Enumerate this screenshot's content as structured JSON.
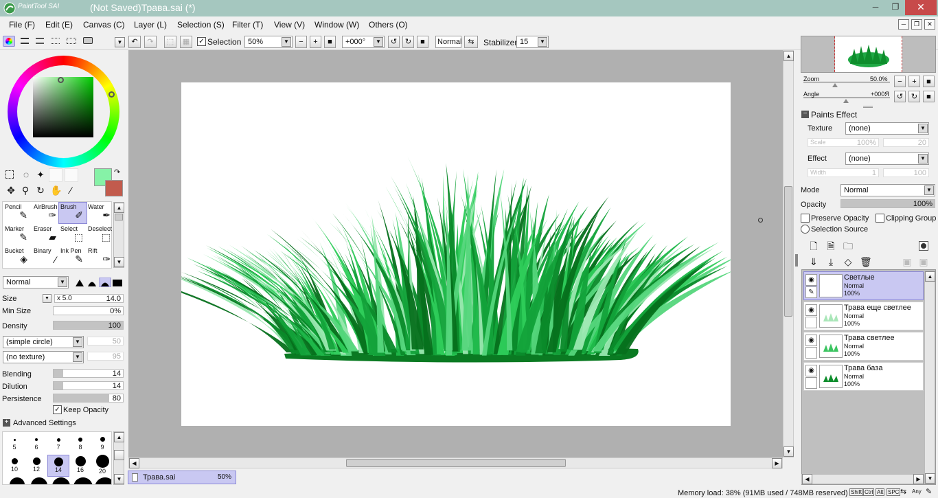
{
  "window": {
    "app_logo_text": "PaintTool SAI",
    "title": "(Not Saved)Трава.sai (*)",
    "minimize": "─",
    "maximize": "❐",
    "close": "✕"
  },
  "menu": [
    "File (F)",
    "Edit (E)",
    "Canvas (C)",
    "Layer (L)",
    "Selection (S)",
    "Filter (T)",
    "View (V)",
    "Window (W)",
    "Others (O)"
  ],
  "toolbar": {
    "selection_label": "Selection",
    "selection_checked": true,
    "zoom": "50%",
    "angle": "+000°",
    "blend_mode": "Normal",
    "stabilizer_label": "Stabilizer",
    "stabilizer_value": "15"
  },
  "colors": {
    "foreground": "#86f2a7",
    "background": "#c25b4d",
    "accent": "#c9c8f2",
    "grass_dark": "#007f1f",
    "grass_light": "#2ecc5a"
  },
  "tools": [
    {
      "label": "Pencil",
      "icon": "pencil-icon"
    },
    {
      "label": "AirBrush",
      "icon": "airbrush-icon"
    },
    {
      "label": "Brush",
      "icon": "brush-icon",
      "active": true
    },
    {
      "label": "Water",
      "icon": "water-icon"
    },
    {
      "label": "Marker",
      "icon": "marker-icon"
    },
    {
      "label": "Eraser",
      "icon": "eraser-icon"
    },
    {
      "label": "Select",
      "icon": "select-icon"
    },
    {
      "label": "Deselect",
      "icon": "deselect-icon"
    },
    {
      "label": "Bucket",
      "icon": "bucket-icon"
    },
    {
      "label": "Binary",
      "icon": "binary-icon"
    },
    {
      "label": "Ink Pen",
      "icon": "ink-pen-icon"
    },
    {
      "label": "Rift",
      "icon": "rift-icon"
    }
  ],
  "brush": {
    "mode": "Normal",
    "size_label": "Size",
    "size_multiplier": "x 5.0",
    "size_value": "14.0",
    "min_size_label": "Min Size",
    "min_size_value": "0%",
    "density_label": "Density",
    "density_value": "100",
    "shape": "(simple circle)",
    "shape_value": "50",
    "texture": "(no texture)",
    "texture_value": "95",
    "blending_label": "Blending",
    "blending_value": "14",
    "dilution_label": "Dilution",
    "dilution_value": "14",
    "persistence_label": "Persistence",
    "persistence_value": "80",
    "keep_opacity_label": "Keep Opacity",
    "keep_opacity_checked": true,
    "advanced_label": "Advanced Settings"
  },
  "brush_sizes": [
    "5",
    "6",
    "7",
    "8",
    "9",
    "10",
    "12",
    "14",
    "16",
    "20"
  ],
  "brush_size_selected": "14",
  "file_tab": {
    "name": "Трава.sai",
    "zoom": "50%"
  },
  "status": {
    "memory": "Memory load: 38% (91MB used / 748MB reserved)",
    "keys": [
      "Shift",
      "Ctrl",
      "Alt",
      "SPC",
      "Any"
    ]
  },
  "navigator": {
    "zoom_label": "Zoom",
    "zoom_value": "50.0%",
    "angle_label": "Angle",
    "angle_value": "+000Я"
  },
  "paints_effect": {
    "header": "Paints Effect",
    "texture_label": "Texture",
    "texture_value": "(none)",
    "scale_label": "Scale",
    "scale_value": "100%",
    "scale_value2": "20",
    "effect_label": "Effect",
    "effect_value": "(none)",
    "width_label": "Width",
    "width_value": "1",
    "width_value2": "100"
  },
  "layer_props": {
    "mode_label": "Mode",
    "mode_value": "Normal",
    "opacity_label": "Opacity",
    "opacity_value": "100%",
    "preserve_label": "Preserve Opacity",
    "clipping_label": "Clipping Group",
    "selection_source_label": "Selection Source"
  },
  "layers": [
    {
      "name": "Светлые",
      "mode": "Normal",
      "opacity": "100%",
      "active": true
    },
    {
      "name": "Трава еще светлее",
      "mode": "Normal",
      "opacity": "100%"
    },
    {
      "name": "Трава светлее",
      "mode": "Normal",
      "opacity": "100%"
    },
    {
      "name": "Трава база",
      "mode": "Normal",
      "opacity": "100%"
    }
  ]
}
